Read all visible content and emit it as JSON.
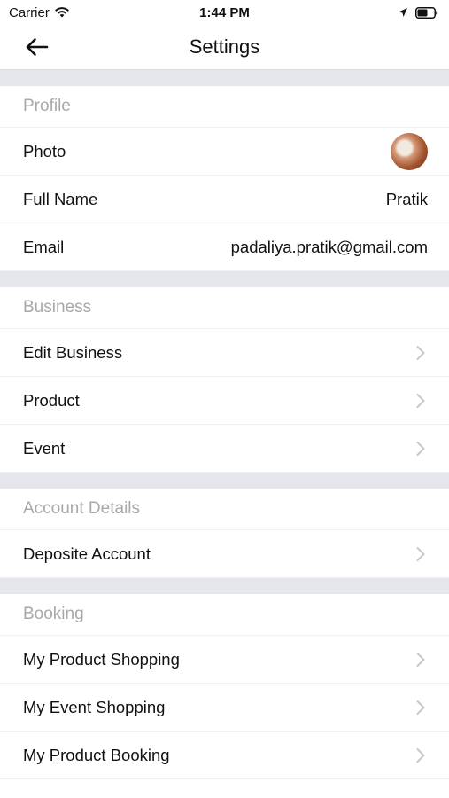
{
  "status_bar": {
    "carrier": "Carrier",
    "time": "1:44 PM"
  },
  "nav": {
    "title": "Settings"
  },
  "sections": {
    "profile": {
      "title": "Profile",
      "photo_label": "Photo",
      "fullname_label": "Full Name",
      "fullname_value": "Pratik",
      "email_label": "Email",
      "email_value": "padaliya.pratik@gmail.com"
    },
    "business": {
      "title": "Business",
      "items": [
        "Edit Business",
        "Product",
        "Event"
      ]
    },
    "account": {
      "title": "Account Details",
      "items": [
        "Deposite Account"
      ]
    },
    "booking": {
      "title": "Booking",
      "items": [
        "My Product Shopping",
        "My Event Shopping",
        "My Product Booking"
      ]
    }
  },
  "icons": {
    "back": "arrow-left-icon",
    "chevron": "chevron-right-icon",
    "wifi": "wifi-icon",
    "location": "location-arrow-icon",
    "battery": "battery-icon"
  },
  "colors": {
    "section_gap": "#e4e6ec",
    "section_title": "#a8a8ac",
    "chevron": "#c7c7cc",
    "divider": "#eeeff2"
  }
}
